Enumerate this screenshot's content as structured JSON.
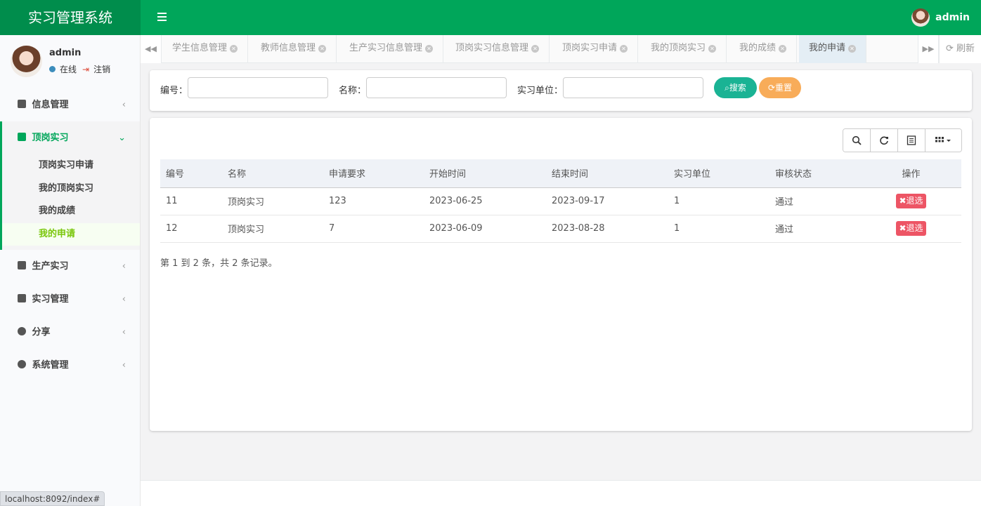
{
  "app": {
    "title": "实习管理系统",
    "user": "admin"
  },
  "sidebar": {
    "user_name": "admin",
    "status_online": "在线",
    "logout": "注销",
    "menu": [
      {
        "label": "信息管理",
        "icon": "user-icon"
      },
      {
        "label": "顶岗实习",
        "icon": "id-card-icon",
        "open": true,
        "children": [
          "顶岗实习申请",
          "我的顶岗实习",
          "我的成绩",
          "我的申请"
        ],
        "active_child": "我的申请"
      },
      {
        "label": "生产实习",
        "icon": "user-square-icon"
      },
      {
        "label": "实习管理",
        "icon": "address-card-icon"
      },
      {
        "label": "分享",
        "icon": "comment-icon"
      },
      {
        "label": "系统管理",
        "icon": "gear-icon"
      }
    ]
  },
  "tabs": {
    "items": [
      "学生信息管理",
      "教师信息管理",
      "生产实习信息管理",
      "顶岗实习信息管理",
      "顶岗实习申请",
      "我的顶岗实习",
      "我的成绩",
      "我的申请"
    ],
    "active": "我的申请",
    "refresh_label": "刷新"
  },
  "search": {
    "fields": [
      {
        "label": "编号：",
        "value": ""
      },
      {
        "label": "名称：",
        "value": ""
      },
      {
        "label": "实习单位：",
        "value": ""
      }
    ],
    "search_label": "搜索",
    "reset_label": "重置"
  },
  "table": {
    "columns": [
      "编号",
      "名称",
      "申请要求",
      "开始时间",
      "结束时间",
      "实习单位",
      "审核状态",
      "操作"
    ],
    "rows": [
      [
        "11",
        "顶岗实习",
        "123",
        "2023-06-25",
        "2023-09-17",
        "1",
        "通过",
        "退选"
      ],
      [
        "12",
        "顶岗实习",
        "7",
        "2023-06-09",
        "2023-08-28",
        "1",
        "通过",
        "退选"
      ]
    ],
    "pager_info": "第 1 到 2 条，共 2 条记录。"
  },
  "status_bar": {
    "url": "localhost:8092/index#"
  },
  "colors": {
    "brand": "#00a65a",
    "brand_dark": "#008d4c",
    "search": "#1ab394",
    "reset": "#f8ac59",
    "danger": "#ed5565"
  }
}
